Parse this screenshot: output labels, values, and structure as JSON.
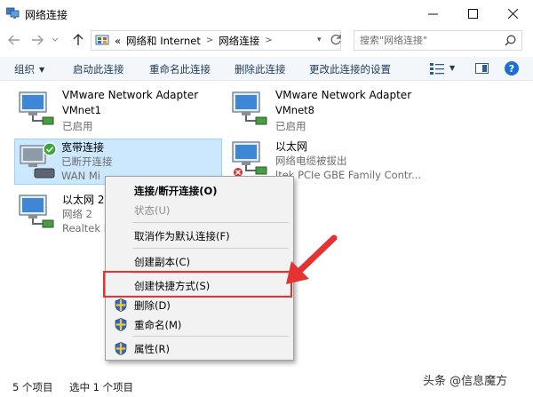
{
  "window": {
    "title": "网络连接",
    "icon": "network-connections-icon"
  },
  "navigation": {
    "breadcrumb_prefix": "«",
    "breadcrumb": [
      "网络和 Internet",
      "网络连接"
    ],
    "search_placeholder": "搜索\"网络连接\""
  },
  "toolbar": {
    "organize": "组织",
    "start_connection": "启动此连接",
    "rename_connection": "重命名此连接",
    "delete_connection": "删除此连接",
    "change_settings": "更改此连接的设置"
  },
  "connections": [
    {
      "name": "VMware Network Adapter",
      "line1": "VMnet1",
      "line2": "已启用"
    },
    {
      "name": "VMware Network Adapter",
      "line1": "VMnet8",
      "line2": "已启用"
    },
    {
      "name": "宽带连接",
      "line1": "已断开连接",
      "line2": "WAN Mi"
    },
    {
      "name": "以太网",
      "line1": "网络电缆被拔出",
      "line2": "ltek PCIe GBE Family Contr..."
    },
    {
      "name": "以太网 2",
      "line1": "网络 2",
      "line2": "Realtek P"
    }
  ],
  "context_menu": {
    "connect_disconnect": "连接/断开连接(O)",
    "status": "状态(U)",
    "cancel_default": "取消作为默认连接(F)",
    "create_copy": "创建副本(C)",
    "create_shortcut": "创建快捷方式(S)",
    "delete": "删除(D)",
    "rename": "重命名(M)",
    "properties": "属性(R)"
  },
  "status_bar": {
    "item_count": "5 个项目",
    "selected_count": "选中 1 个项目"
  },
  "watermark": "头条 @信息魔方",
  "colors": {
    "selection_bg": "#cce8ff",
    "highlight_red": "#e53333",
    "command_text": "#1e3955",
    "help_blue": "#1d6fcf"
  }
}
